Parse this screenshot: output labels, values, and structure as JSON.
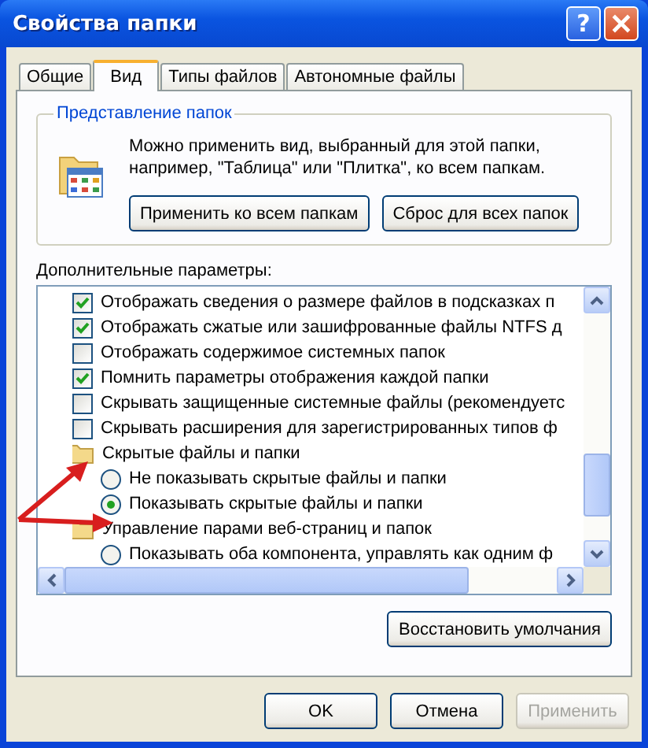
{
  "window": {
    "title": "Свойства папки",
    "help_label": "?"
  },
  "tabs": [
    {
      "label": "Общие",
      "selected": false
    },
    {
      "label": "Вид",
      "selected": true
    },
    {
      "label": "Типы файлов",
      "selected": false
    },
    {
      "label": "Автономные файлы",
      "selected": false
    }
  ],
  "folder_views": {
    "title": "Представление папок",
    "description": "Можно применить вид, выбранный для этой папки, например, \"Таблица\" или \"Плитка\", ко всем папкам.",
    "buttons": [
      "Применить ко всем папкам",
      "Сброс для всех папок"
    ]
  },
  "advanced": {
    "label": "Дополнительные параметры:",
    "items": [
      {
        "kind": "checkbox",
        "label": "Отображать сведения о размере файлов в подсказках п",
        "checked": true
      },
      {
        "kind": "checkbox",
        "label": "Отображать сжатые или зашифрованные файлы NTFS д",
        "checked": true
      },
      {
        "kind": "checkbox",
        "label": "Отображать содержимое системных папок",
        "checked": false
      },
      {
        "kind": "checkbox",
        "label": "Помнить параметры отображения каждой папки",
        "checked": true
      },
      {
        "kind": "checkbox",
        "label": "Скрывать защищенные системные файлы (рекомендуетс",
        "checked": false
      },
      {
        "kind": "checkbox",
        "label": "Скрывать расширения для зарегистрированных типов ф",
        "checked": false
      },
      {
        "kind": "folder",
        "label": "Скрытые файлы и папки",
        "children": [
          {
            "kind": "radio",
            "label": "Не показывать скрытые файлы и папки",
            "selected": false
          },
          {
            "kind": "radio",
            "label": "Показывать скрытые файлы и папки",
            "selected": true
          }
        ]
      },
      {
        "kind": "folder",
        "label": "Управление парами веб-страниц и папок",
        "children": [
          {
            "kind": "radio",
            "label": "Показывать оба компонента, управлять как одним ф",
            "selected": false
          }
        ]
      }
    ]
  },
  "restore_button": "Восстановить умолчания",
  "dialog_buttons": [
    {
      "label": "OK",
      "disabled": false
    },
    {
      "label": "Отмена",
      "disabled": false
    },
    {
      "label": "Применить",
      "disabled": true
    }
  ]
}
